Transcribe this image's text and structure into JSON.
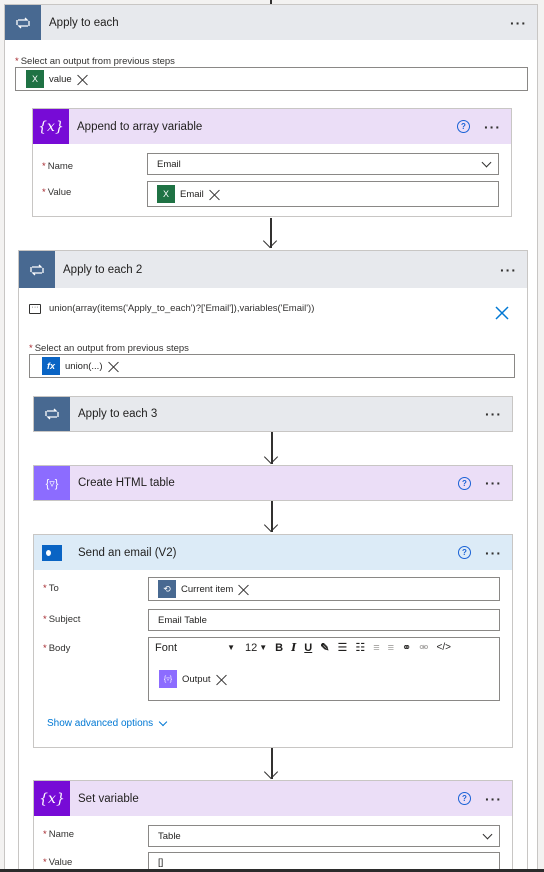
{
  "apply1": {
    "title": "Apply to each",
    "select_label": "Select an output from previous steps",
    "token": "value",
    "append": {
      "title": "Append to array variable",
      "name_label": "Name",
      "name_value": "Email",
      "value_label": "Value",
      "value_token": "Email"
    }
  },
  "apply2": {
    "title": "Apply to each 2",
    "expression": "union(array(items('Apply_to_each')?['Email']),variables('Email'))",
    "select_label": "Select an output from previous steps",
    "token": "union(...)",
    "token_icon": "fx",
    "apply3": {
      "title": "Apply to each 3"
    },
    "html_table": {
      "title": "Create HTML table"
    },
    "email": {
      "title": "Send an email (V2)",
      "to_label": "To",
      "to_token": "Current item",
      "subject_label": "Subject",
      "subject_value": "Email Table",
      "body_label": "Body",
      "font_label": "Font",
      "font_size": "12",
      "body_token": "Output",
      "advanced_link": "Show advanced options"
    }
  },
  "set_var": {
    "title": "Set variable",
    "name_label": "Name",
    "name_value": "Table",
    "value_label": "Value",
    "value_value": "[]"
  },
  "icons": {
    "loop": "loop-icon",
    "variable": "variable-icon",
    "html": "html-table-icon",
    "outlook": "outlook-icon",
    "excel": "excel-icon",
    "comment": "comment-icon",
    "close": "close-icon",
    "help": "help-icon",
    "more": "more-icon"
  },
  "colors": {
    "loop": "#486991",
    "variable": "#770bd6",
    "html": "#8c6cff",
    "outlook": "#0a64c4",
    "excel": "#1f7244",
    "link": "#0078d4"
  }
}
